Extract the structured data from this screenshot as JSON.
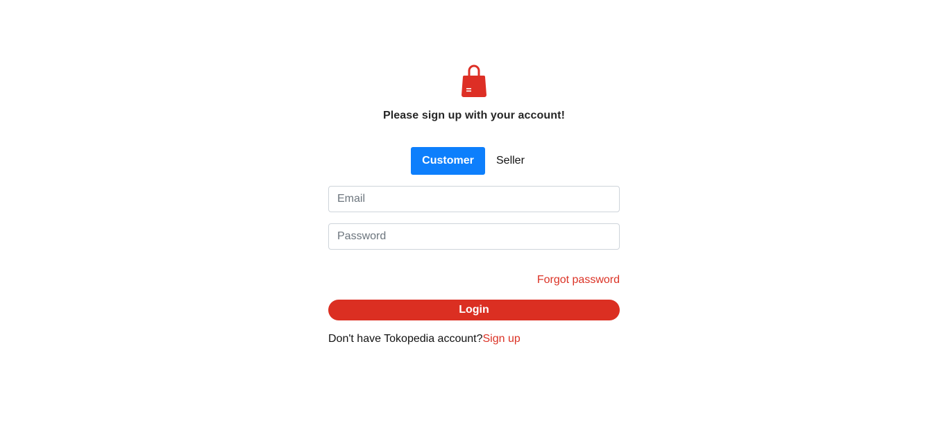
{
  "brand": {
    "logo_icon": "shopping-bag-icon",
    "color": "#dd2f25"
  },
  "subtitle": "Please sign up with your account!",
  "tabs": [
    {
      "label": "Customer",
      "active": true
    },
    {
      "label": "Seller",
      "active": false
    }
  ],
  "form": {
    "email_placeholder": "Email",
    "email_value": "",
    "password_placeholder": "Password",
    "password_value": "",
    "forgot_label": "Forgot password",
    "login_label": "Login"
  },
  "footer": {
    "prompt": "Don't have Tokopedia account?",
    "signup_label": "Sign up"
  },
  "colors": {
    "accent_blue": "#0d7ffc",
    "accent_red": "#db2f22"
  }
}
